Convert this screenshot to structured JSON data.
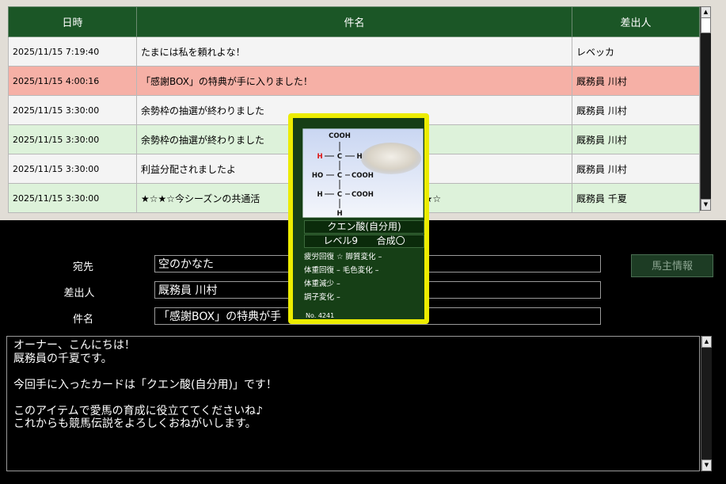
{
  "mail_list": {
    "headers": {
      "date": "日時",
      "subject": "件名",
      "sender": "差出人"
    },
    "rows": [
      {
        "date": "2025/11/15 7:19:40",
        "subject": "たまには私を頼れよな！",
        "sender": "レベッカ"
      },
      {
        "date": "2025/11/15 4:00:16",
        "subject": "「感謝BOX」の特典が手に入りました！",
        "sender": "厩務員 川村"
      },
      {
        "date": "2025/11/15 3:30:00",
        "subject": "余勢枠の抽選が終わりました",
        "sender": "厩務員 川村"
      },
      {
        "date": "2025/11/15 3:30:00",
        "subject": "余勢枠の抽選が終わりました",
        "sender": "厩務員 川村"
      },
      {
        "date": "2025/11/15 3:30:00",
        "subject": "利益分配されましたよ",
        "sender": "厩務員 川村"
      },
      {
        "date": "2025/11/15 3:30:00",
        "subject": "★☆★☆今シーズンの共通活",
        "subject_tail": "♪★☆★☆",
        "sender": "厩務員 千夏"
      }
    ]
  },
  "detail": {
    "to_label": "宛先",
    "to_value": "空のかなた",
    "from_label": "差出人",
    "from_value": "厩務員 川村",
    "subject_label": "件名",
    "subject_value": "「感謝BOX」の特典が手",
    "owner_info_button": "馬主情報",
    "body_lines": [
      "オーナー、こんにちは！",
      "厩務員の千夏です。",
      "",
      "今回手に入ったカードは「クエン酸(自分用)」です！",
      "",
      "このアイテムで愛馬の育成に役立ててくださいね♪",
      "これからも競馬伝説をよろしくおねがいします。"
    ]
  },
  "item_card": {
    "name": "クエン酸(自分用)",
    "level": "レベル9",
    "synthesis": "合成〇",
    "stats": [
      "疲労回復 ☆ 脚質変化 –",
      "体重回復 – 毛色変化 –",
      "体重減少 –",
      "調子変化 –"
    ],
    "number": "No. 4241",
    "formula": {
      "top": "COOH",
      "row1_left": "H",
      "row1_c": "C",
      "row1_right": "H",
      "row2_left": "HO",
      "row2_c": "C",
      "row2_right": "COOH",
      "row3_left": "H",
      "row3_c": "C",
      "row3_right": "COOH",
      "bottom": "H"
    }
  },
  "colors": {
    "header_green": "#1b5626",
    "row_red": "#f6b0a6",
    "row_green": "#ddf2da",
    "link_blue": "#1b3fd4",
    "card_yellow": "#ecec00"
  }
}
